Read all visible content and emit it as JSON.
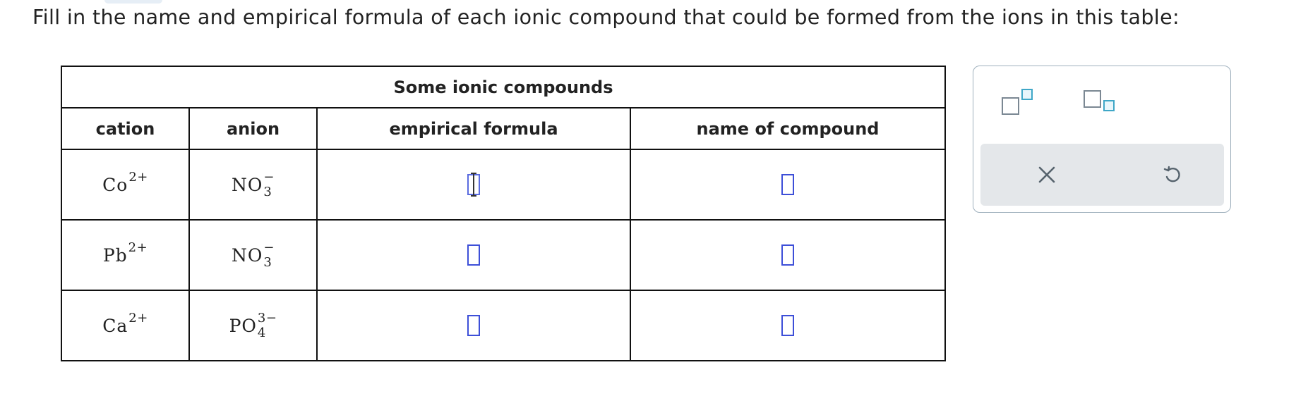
{
  "instruction": "Fill in the name and empirical formula of each ionic compound that could be formed from the ions in this table:",
  "table": {
    "caption": "Some ionic compounds",
    "headers": {
      "cation": "cation",
      "anion": "anion",
      "formula": "empirical formula",
      "name": "name of compound"
    },
    "rows": [
      {
        "cation": {
          "symbol": "Co",
          "charge": "2+"
        },
        "anion": {
          "symbol": "NO",
          "subscript": "3",
          "charge": "−"
        },
        "formula_value": "",
        "name_value": ""
      },
      {
        "cation": {
          "symbol": "Pb",
          "charge": "2+"
        },
        "anion": {
          "symbol": "NO",
          "subscript": "3",
          "charge": "−"
        },
        "formula_value": "",
        "name_value": ""
      },
      {
        "cation": {
          "symbol": "Ca",
          "charge": "2+"
        },
        "anion": {
          "symbol": "PO",
          "subscript": "4",
          "charge": "3−"
        },
        "formula_value": "",
        "name_value": ""
      }
    ]
  },
  "palette": {
    "tools": [
      "superscript-icon",
      "subscript-icon"
    ],
    "actions": [
      "close-icon",
      "undo-icon"
    ],
    "colors": {
      "accent": "#3d4fd8",
      "icon_gray": "#7b8893",
      "icon_blue": "#3fa7c7",
      "bar": "#e4e7ea"
    }
  }
}
